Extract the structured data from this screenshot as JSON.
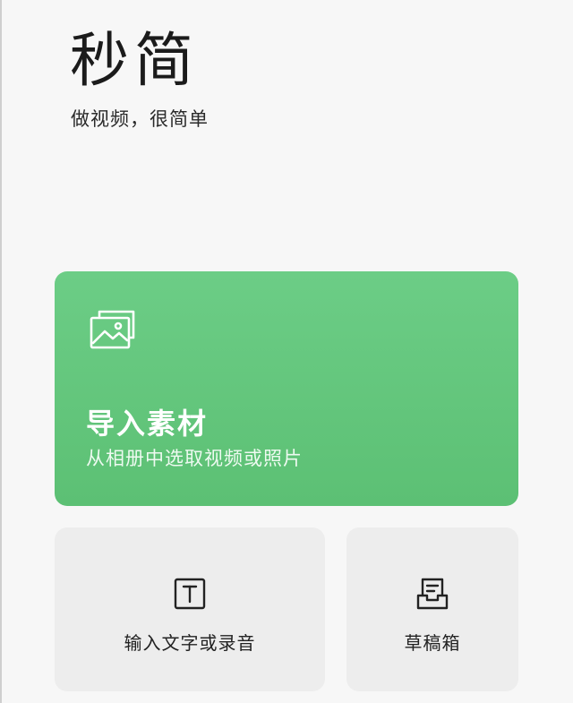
{
  "app": {
    "logo_text": "秒简",
    "slogan": "做视频，很简单"
  },
  "import_card": {
    "icon": "image-gallery-icon",
    "title": "导入素材",
    "subtitle": "从相册中选取视频或照片",
    "background_color": "#62c67c"
  },
  "tiles": {
    "text_input": {
      "icon": "text-box-icon",
      "label": "输入文字或录音"
    },
    "drafts": {
      "icon": "draft-tray-icon",
      "label": "草稿箱"
    }
  }
}
